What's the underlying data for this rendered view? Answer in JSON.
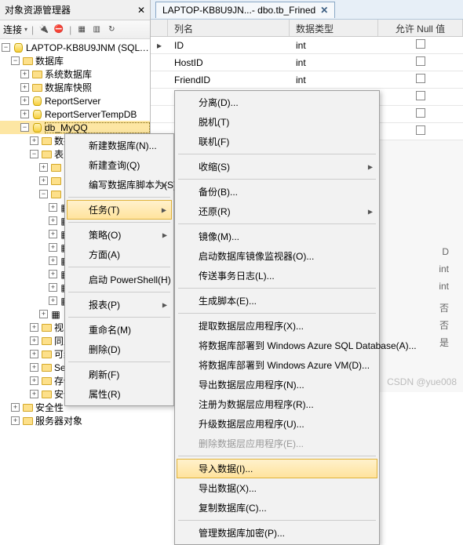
{
  "pane_title": "对象资源管理器",
  "toolbar_label": "连接",
  "server_label": "LAPTOP-KB8U9JNM (SQL Server",
  "tree": {
    "root": "数据库",
    "children": [
      {
        "label": "系统数据库"
      },
      {
        "label": "数据库快照"
      },
      {
        "label": "ReportServer"
      },
      {
        "label": "ReportServerTempDB"
      },
      {
        "label": "db_MyQQ",
        "selected": true
      }
    ],
    "dbmyqq_nodes": [
      "数据",
      "表",
      "视图",
      "同义词",
      "可编程性",
      "Service Broker",
      "存储",
      "安全性"
    ],
    "last_node": "服务器对象",
    "security_node": "安全性"
  },
  "tab_title": "LAPTOP-KB8U9JN...- dbo.tb_Frined",
  "grid": {
    "headers": {
      "name": "列名",
      "type": "数据类型",
      "null": "允许 Null 值"
    },
    "rows": [
      {
        "arrow": true,
        "name": "ID",
        "type": "int"
      },
      {
        "arrow": false,
        "name": "HostID",
        "type": "int"
      },
      {
        "arrow": false,
        "name": "FriendID",
        "type": "int"
      }
    ]
  },
  "menu1": {
    "items": [
      {
        "label": "新建数据库(N)..."
      },
      {
        "label": "新建查询(Q)"
      },
      {
        "label": "编写数据库脚本为(S)",
        "sub": true
      },
      {
        "label": "任务(T)",
        "sub": true,
        "hl": true
      },
      {
        "label": "策略(O)",
        "sub": true
      },
      {
        "label": "方面(A)"
      },
      {
        "label": "启动 PowerShell(H)"
      },
      {
        "label": "报表(P)",
        "sub": true
      },
      {
        "label": "重命名(M)"
      },
      {
        "label": "删除(D)"
      },
      {
        "label": "刷新(F)"
      },
      {
        "label": "属性(R)"
      }
    ]
  },
  "menu2": {
    "items": [
      {
        "label": "分离(D)..."
      },
      {
        "label": "脱机(T)"
      },
      {
        "label": "联机(F)"
      },
      {
        "label": "收缩(S)",
        "sub": true
      },
      {
        "label": "备份(B)..."
      },
      {
        "label": "还原(R)",
        "sub": true
      },
      {
        "label": "镜像(M)..."
      },
      {
        "label": "启动数据库镜像监视器(O)..."
      },
      {
        "label": "传送事务日志(L)..."
      },
      {
        "label": "生成脚本(E)..."
      },
      {
        "label": "提取数据层应用程序(X)..."
      },
      {
        "label": "将数据库部署到 Windows Azure SQL Database(A)..."
      },
      {
        "label": "将数据库部署到 Windows Azure VM(D)..."
      },
      {
        "label": "导出数据层应用程序(N)..."
      },
      {
        "label": "注册为数据层应用程序(R)..."
      },
      {
        "label": "升级数据层应用程序(U)..."
      },
      {
        "label": "删除数据层应用程序(E)...",
        "disabled": true
      },
      {
        "label": "导入数据(I)...",
        "hl": true
      },
      {
        "label": "导出数据(X)..."
      },
      {
        "label": "复制数据库(C)..."
      },
      {
        "label": "管理数据库加密(P)..."
      }
    ]
  },
  "bg_hints": [
    "D",
    "int",
    "int",
    "否",
    "否",
    "是"
  ],
  "watermark": "CSDN @yue008"
}
